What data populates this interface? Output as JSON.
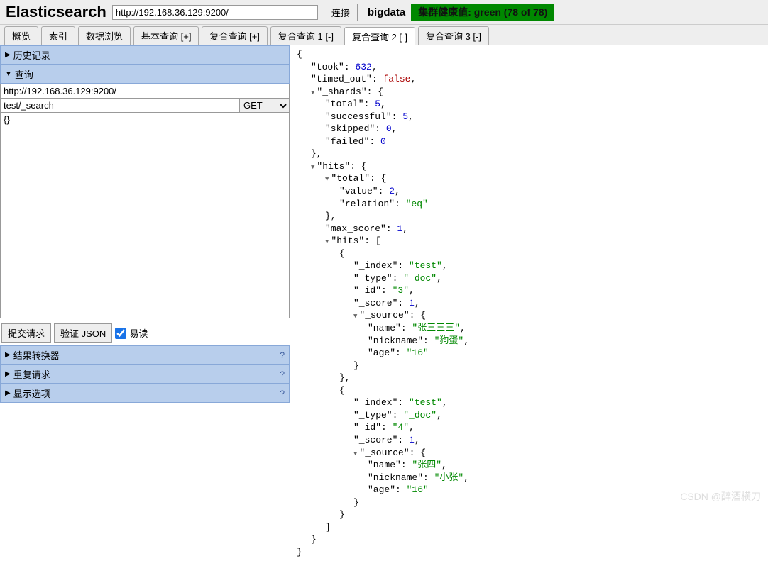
{
  "header": {
    "logo": "Elasticsearch",
    "url": "http://192.168.36.129:9200/",
    "connect": "连接",
    "cluster": "bigdata",
    "health": "集群健康值: green (78 of 78)"
  },
  "tabs": [
    {
      "label": "概览"
    },
    {
      "label": "索引"
    },
    {
      "label": "数据浏览"
    },
    {
      "label": "基本查询 [+]"
    },
    {
      "label": "复合查询 [+]"
    },
    {
      "label": "复合查询 1 [-]"
    },
    {
      "label": "复合查询 2 [-]",
      "active": true
    },
    {
      "label": "复合查询 3 [-]"
    }
  ],
  "panels": {
    "history": "历史记录",
    "query": "查询",
    "transformer": "结果转换器",
    "repeat": "重复请求",
    "display": "显示选项"
  },
  "query": {
    "url": "http://192.168.36.129:9200/",
    "path": "test/_search",
    "method": "GET",
    "body": "{}"
  },
  "actions": {
    "submit": "提交请求",
    "validate": "验证 JSON",
    "pretty": "易读"
  },
  "help": "?",
  "result": {
    "took": 632,
    "timed_out": false,
    "_shards": {
      "total": 5,
      "successful": 5,
      "skipped": 0,
      "failed": 0
    },
    "hits": {
      "total": {
        "value": 2,
        "relation": "eq"
      },
      "max_score": 1,
      "hits": [
        {
          "_index": "test",
          "_type": "_doc",
          "_id": "3",
          "_score": 1,
          "_source": {
            "name": "张三三三",
            "nickname": "狗蛋",
            "age": "16"
          }
        },
        {
          "_index": "test",
          "_type": "_doc",
          "_id": "4",
          "_score": 1,
          "_source": {
            "name": "张四",
            "nickname": "小张",
            "age": "16"
          }
        }
      ]
    }
  },
  "watermark": "CSDN @醉酒横刀"
}
